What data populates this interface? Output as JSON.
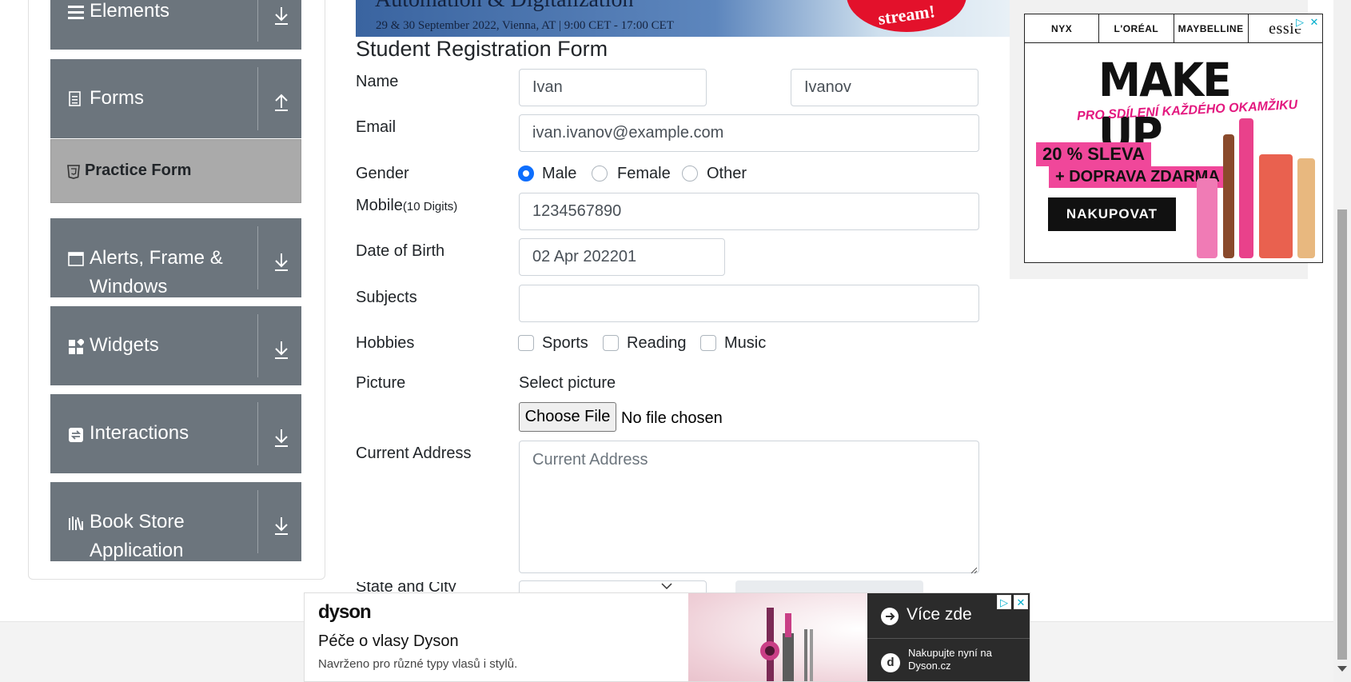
{
  "sidebar": {
    "groups": [
      {
        "label": "Elements",
        "icon": "hamburger-icon",
        "arrow": "download-arrow-icon"
      },
      {
        "label": "Forms",
        "icon": "form-icon",
        "arrow": "upload-arrow-icon"
      },
      {
        "label": "Alerts, Frame & Windows",
        "icon": "window-icon",
        "arrow": "download-arrow-icon"
      },
      {
        "label": "Widgets",
        "icon": "widgets-icon",
        "arrow": "download-arrow-icon"
      },
      {
        "label": "Interactions",
        "icon": "interactions-icon",
        "arrow": "download-arrow-icon"
      },
      {
        "label": "Book Store Application",
        "icon": "library-icon",
        "arrow": "download-arrow-icon"
      }
    ],
    "active_item": {
      "label": "Practice Form",
      "icon": "html5-icon"
    }
  },
  "top_banner": {
    "headline": "Automation & Digitalization",
    "subline": "29 & 30 September 2022, Vienna, AT | 9:00 CET - 17:00 CET",
    "badge": "stream!"
  },
  "form": {
    "title": "Student Registration Form",
    "name": {
      "label": "Name",
      "first_value": "Ivan",
      "last_value": "Ivanov"
    },
    "email": {
      "label": "Email",
      "value": "ivan.ivanov@example.com"
    },
    "gender": {
      "label": "Gender",
      "options": [
        "Male",
        "Female",
        "Other"
      ],
      "selected": "Male"
    },
    "mobile": {
      "label": "Mobile",
      "hint": "(10 Digits)",
      "value": "1234567890"
    },
    "dob": {
      "label": "Date of Birth",
      "value": "02 Apr 202201"
    },
    "subjects": {
      "label": "Subjects",
      "value": ""
    },
    "hobbies": {
      "label": "Hobbies",
      "options": [
        "Sports",
        "Reading",
        "Music"
      ],
      "checked": []
    },
    "picture": {
      "label": "Picture",
      "select_text": "Select picture",
      "button": "Choose File",
      "status": "No file chosen"
    },
    "address": {
      "label": "Current Address",
      "placeholder": "Current Address"
    },
    "state_city": {
      "label": "State and City"
    }
  },
  "right_ad": {
    "brands": [
      "NYX",
      "L'ORÉAL",
      "MAYBELLINE",
      "essie"
    ],
    "title": "MAKE UP",
    "subtitle": "PRO SDÍLENÍ KAŽDÉHO OKAMŽIKU",
    "promo_1": "20 % SLEVA",
    "promo_2": "+ DOPRAVA ZDARMA",
    "cta": "NAKUPOVAT",
    "badge_info": "▷",
    "badge_close": "✕"
  },
  "bottom_ad": {
    "brand": "dyson",
    "title": "Péče o vlasy Dyson",
    "subtitle": "Navrženo pro různé typy vlasů i stylů.",
    "cta": "Více zde",
    "shop": "Nakupujte nyní na Dyson.cz",
    "shop_icon_letter": "d",
    "badge_info": "▷",
    "badge_close": "✕"
  },
  "colors": {
    "sidebar_header": "#6c757d",
    "sidebar_active": "#aaaaaa",
    "radio_checked": "#0d6efd"
  }
}
